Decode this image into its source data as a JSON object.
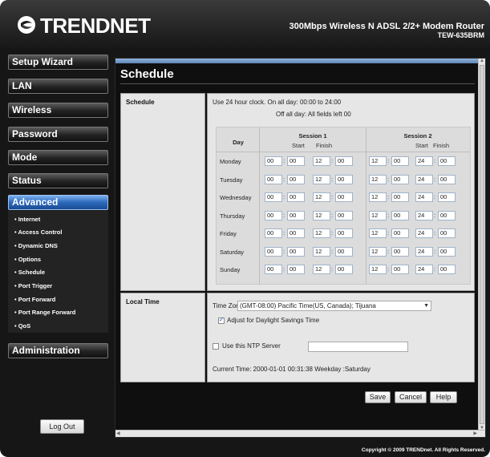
{
  "header": {
    "logo_text": "TRENDNET",
    "model_desc": "300Mbps Wireless N ADSL 2/2+ Modem Router",
    "model_num": "TEW-635BRM"
  },
  "sidebar": {
    "items": [
      {
        "label": "Setup Wizard"
      },
      {
        "label": "LAN"
      },
      {
        "label": "Wireless"
      },
      {
        "label": "Password"
      },
      {
        "label": "Mode"
      },
      {
        "label": "Status"
      },
      {
        "label": "Advanced"
      },
      {
        "label": "Administration"
      }
    ],
    "submenu": [
      "Internet",
      "Access Control",
      "Dynamic DNS",
      "Options",
      "Schedule",
      "Port Trigger",
      "Port Forward",
      "Port Range Forward",
      "QoS"
    ],
    "logout_label": "Log Out"
  },
  "page": {
    "title": "Schedule",
    "schedule_label": "Schedule",
    "note1": "Use 24 hour clock.  On all day: 00:00 to 24:00",
    "note2": "Off all day: All fields left 00",
    "grid": {
      "day_header": "Day",
      "session1": "Session 1",
      "session2": "Session 2",
      "start": "Start",
      "finish": "Finish",
      "rows": [
        {
          "day": "Monday",
          "s1": [
            "00",
            "00",
            "12",
            "00"
          ],
          "s2": [
            "12",
            "00",
            "24",
            "00"
          ]
        },
        {
          "day": "Tuesday",
          "s1": [
            "00",
            "00",
            "12",
            "00"
          ],
          "s2": [
            "12",
            "00",
            "24",
            "00"
          ]
        },
        {
          "day": "Wednesday",
          "s1": [
            "00",
            "00",
            "12",
            "00"
          ],
          "s2": [
            "12",
            "00",
            "24",
            "00"
          ]
        },
        {
          "day": "Thursday",
          "s1": [
            "00",
            "00",
            "12",
            "00"
          ],
          "s2": [
            "12",
            "00",
            "24",
            "00"
          ]
        },
        {
          "day": "Friday",
          "s1": [
            "00",
            "00",
            "12",
            "00"
          ],
          "s2": [
            "12",
            "00",
            "24",
            "00"
          ]
        },
        {
          "day": "Saturday",
          "s1": [
            "00",
            "00",
            "12",
            "00"
          ],
          "s2": [
            "12",
            "00",
            "24",
            "00"
          ]
        },
        {
          "day": "Sunday",
          "s1": [
            "00",
            "00",
            "12",
            "00"
          ],
          "s2": [
            "12",
            "00",
            "24",
            "00"
          ]
        }
      ]
    },
    "local_time_label": "Local Time",
    "time_zone_label": "Time Zone:",
    "time_zone_value": "(GMT-08:00) Pacific Time(US, Canada); Tijuana",
    "dst_label": "Adjust for Daylight Savings Time",
    "dst_checked": true,
    "ntp_label": "Use this NTP Server",
    "ntp_checked": false,
    "ntp_value": "",
    "current_time": "Current Time:  2000-01-01 00:31:38   Weekday :Saturday",
    "buttons": {
      "save": "Save",
      "cancel": "Cancel",
      "help": "Help"
    }
  },
  "footer": "Copyright © 2009 TRENDnet. All Rights Reserved.",
  "colors": {
    "accent": "#2d69bb",
    "panel": "#e6e6e6"
  }
}
